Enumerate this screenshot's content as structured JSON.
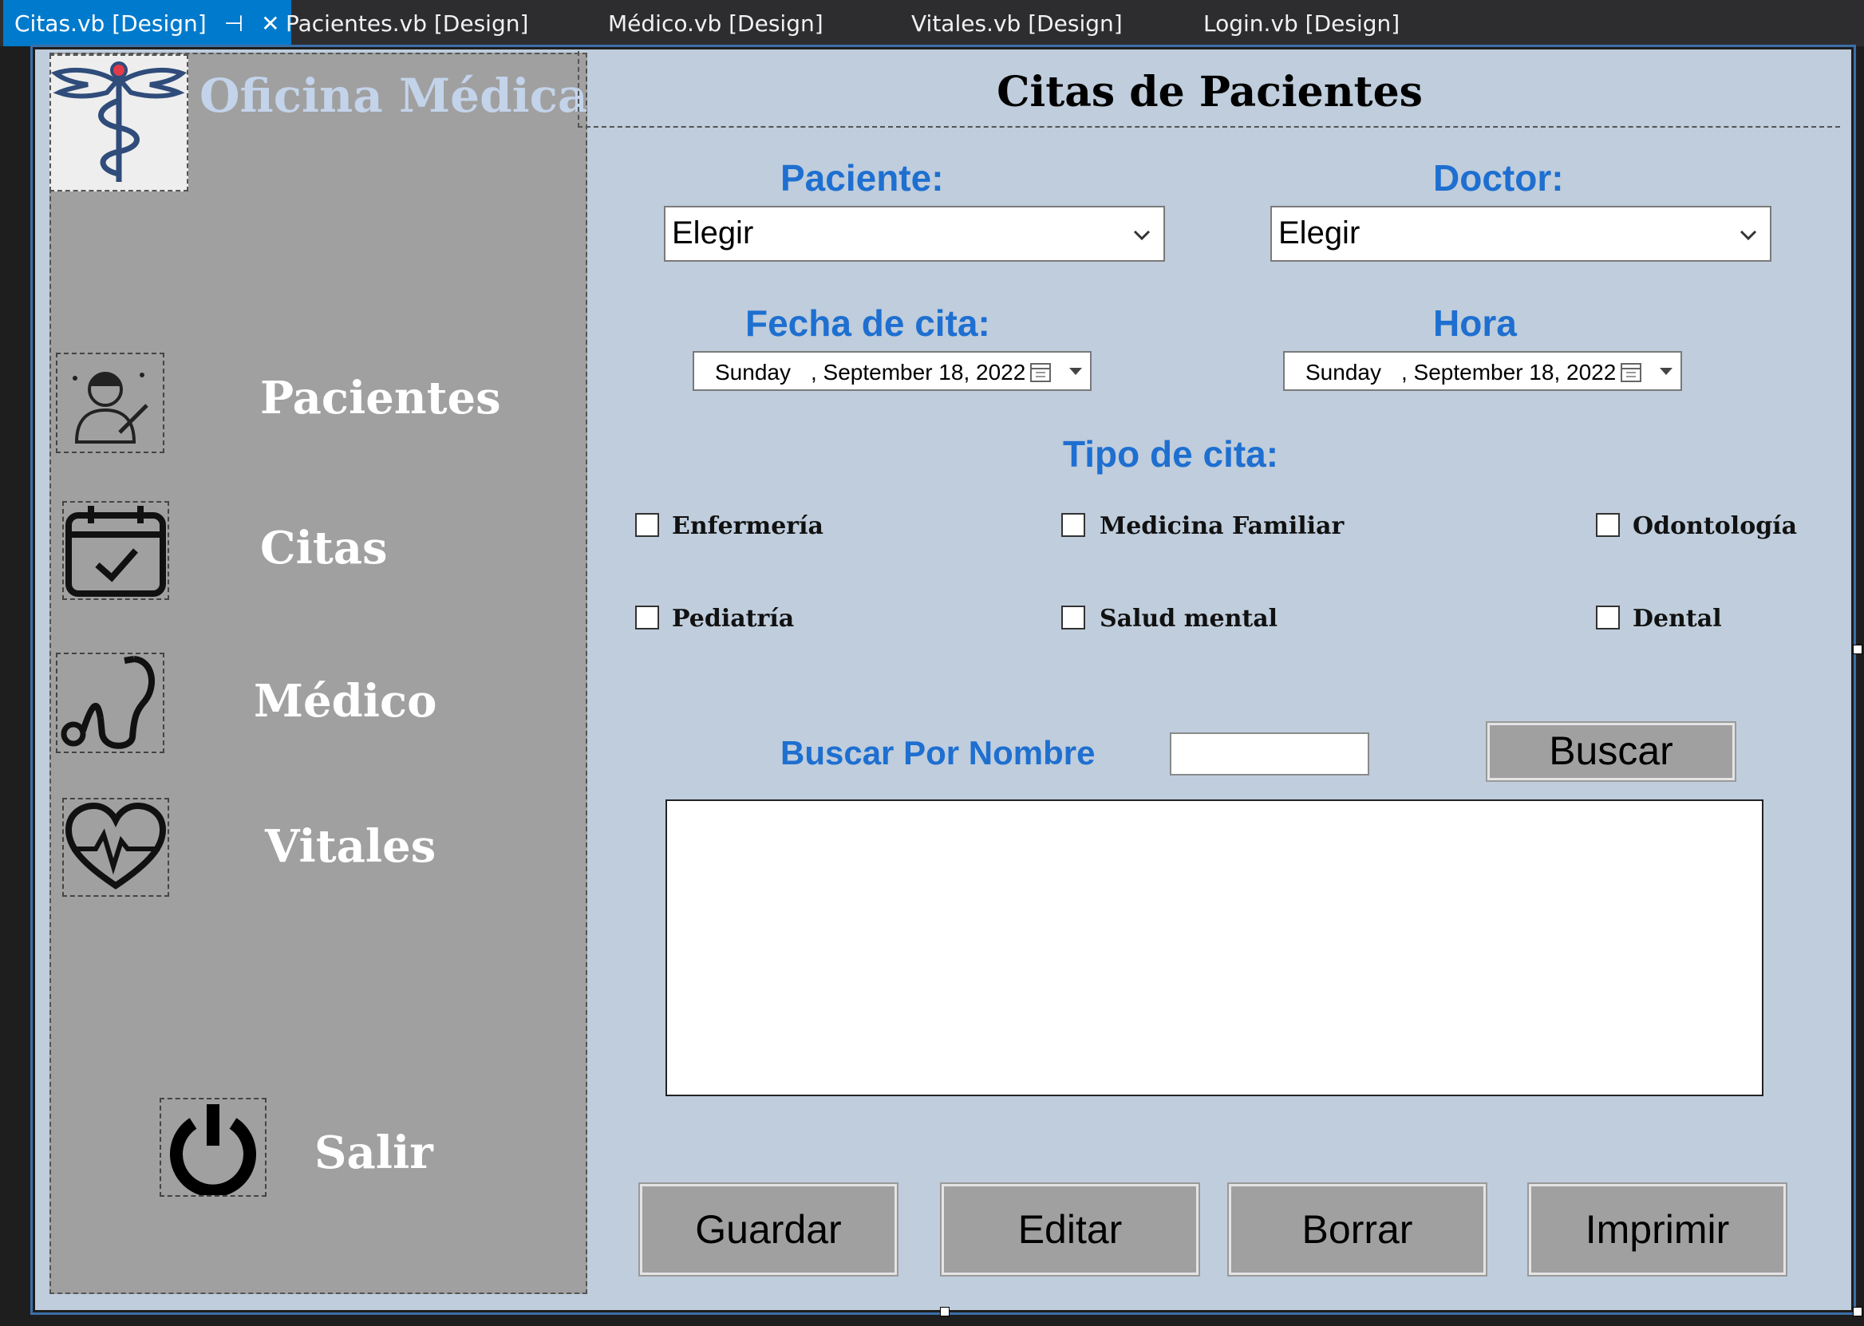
{
  "tabs": [
    {
      "label": "Citas.vb [Design]",
      "active": true
    },
    {
      "label": "Pacientes.vb [Design]",
      "active": false
    },
    {
      "label": "Médico.vb [Design]",
      "active": false
    },
    {
      "label": "Vitales.vb [Design]",
      "active": false
    },
    {
      "label": "Login.vb [Design]",
      "active": false
    }
  ],
  "sidebar": {
    "brand": "Oficina Médica",
    "items": [
      {
        "label": "Pacientes",
        "icon": "doctor-icon"
      },
      {
        "label": "Citas",
        "icon": "calendar-check-icon"
      },
      {
        "label": "Médico",
        "icon": "stethoscope-icon"
      },
      {
        "label": "Vitales",
        "icon": "heartbeat-icon"
      }
    ],
    "exit": {
      "label": "Salir",
      "icon": "power-icon"
    }
  },
  "header": {
    "title": "Citas de Pacientes"
  },
  "form": {
    "patient_label": "Paciente:",
    "patient_value": "Elegir",
    "doctor_label": "Doctor:",
    "doctor_value": "Elegir",
    "date_label": "Fecha de cita:",
    "date_day": "Sunday",
    "date_value": ", September 18, 2022",
    "time_label": "Hora",
    "time_day": "Sunday",
    "time_value": ", September 18, 2022",
    "type_label": "Tipo de cita:",
    "types": [
      "Enfermería",
      "Medicina Familiar",
      "Odontología",
      "Pediatría",
      "Salud mental",
      "Dental"
    ],
    "search_label": "Buscar Por Nombre",
    "search_value": "",
    "search_button": "Buscar"
  },
  "actions": {
    "save": "Guardar",
    "edit": "Editar",
    "delete": "Borrar",
    "print": "Imprimir"
  },
  "colors": {
    "accent": "#1e6fd0",
    "sidebar": "#a0a0a0",
    "form_bg": "#bfcddc",
    "tab_active": "#007acc"
  }
}
